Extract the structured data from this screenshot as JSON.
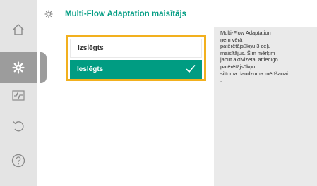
{
  "title": "Multi-Flow Adaptation maisītājs",
  "options": [
    {
      "label": "Izslēgts",
      "selected": false
    },
    {
      "label": "Ieslēgts",
      "selected": true
    }
  ],
  "help_text": "Multi-Flow Adaptation\nņem vērā\npatērētājsūkņu 3 ceļu\nmaisītājus. Šim mērķim\njābūt aktivizētai attiecīgo\npatērētājsūkņu\nsiltuma daudzuma mērīšanai\n.",
  "nav": [
    {
      "icon": "home-icon",
      "active": false
    },
    {
      "icon": "gear-icon",
      "active": true
    },
    {
      "icon": "diagnostics-icon",
      "active": false
    },
    {
      "icon": "back-icon",
      "active": false
    },
    {
      "icon": "help-icon",
      "active": false
    }
  ],
  "colors": {
    "accent": "#009c82",
    "focus": "#f2b01e",
    "rail": "#e4e4e4",
    "rail_active": "#9c9c9c",
    "help_panel": "#eaeaea"
  }
}
